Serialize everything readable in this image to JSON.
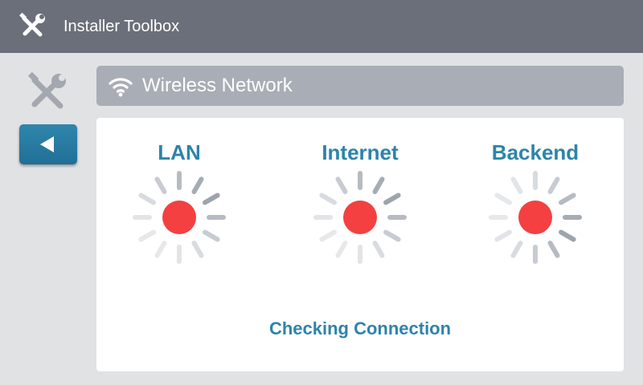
{
  "app": {
    "title": "Installer Toolbox",
    "icon": "tools-icon"
  },
  "sidebar": {
    "tools_icon": "tools-icon",
    "back_button_icon": "back-arrow-icon"
  },
  "section": {
    "title": "Wireless Network",
    "icon": "wifi-icon"
  },
  "checks": [
    {
      "label": "LAN",
      "state_color": "#f44040",
      "icon": "spinner-icon"
    },
    {
      "label": "Internet",
      "state_color": "#f44040",
      "icon": "spinner-icon"
    },
    {
      "label": "Backend",
      "state_color": "#f44040",
      "icon": "spinner-icon"
    }
  ],
  "status_message": "Checking Connection",
  "colors": {
    "topbar": "#6a6f79",
    "accent": "#2d84aa",
    "status_red": "#f44040",
    "header_bar": "#a9adb5"
  }
}
